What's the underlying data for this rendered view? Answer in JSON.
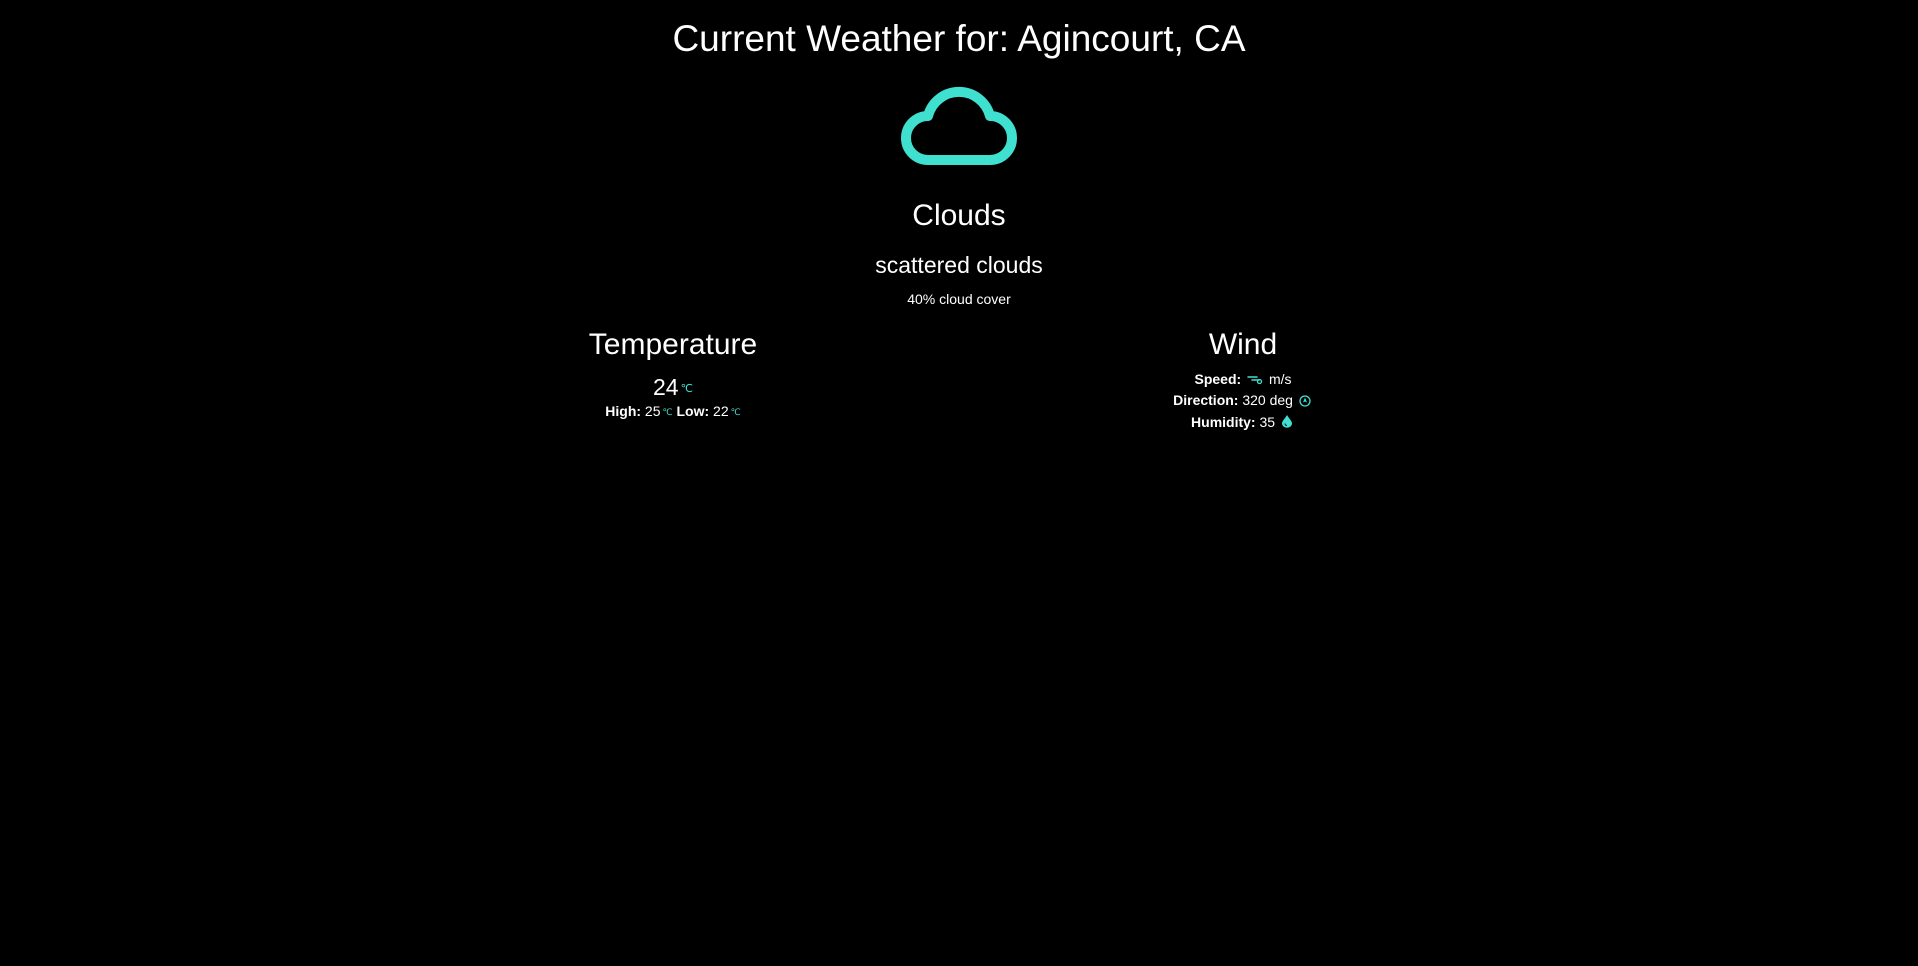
{
  "header": {
    "title": "Current Weather for: Agincourt, CA"
  },
  "icons": {
    "main": "cloud-icon",
    "speed": "wind-icon",
    "direction": "compass-icon",
    "humidity": "droplet-icon"
  },
  "colors": {
    "background": "#000000",
    "text": "#ffffff",
    "accent": "#40e0d0"
  },
  "conditions": {
    "main": "Clouds",
    "description": "scattered clouds",
    "cloud_cover": "40% cloud cover"
  },
  "temperature": {
    "heading": "Temperature",
    "current": "24",
    "unit": "℃",
    "high_label": "High:",
    "high": "25",
    "low_label": "Low:",
    "low": "22"
  },
  "wind": {
    "heading": "Wind",
    "speed_label": "Speed:",
    "speed_unit": "m/s",
    "direction_label": "Direction:",
    "direction": "320 deg",
    "humidity_label": "Humidity:",
    "humidity": "35"
  }
}
